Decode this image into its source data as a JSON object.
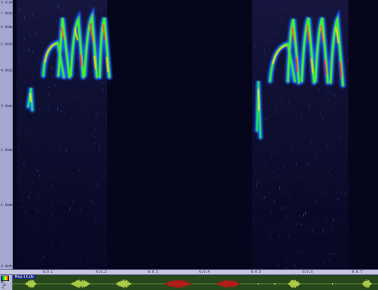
{
  "frequency_axis": {
    "labels": [
      "0.618kHz",
      "7.8kHz",
      "6.8kHz",
      "5.8kHz",
      "4.8kHz",
      "3.8kHz",
      "2.8kHz",
      "1.8kHz",
      "0.8kHz"
    ]
  },
  "time_axis": {
    "labels": [
      "0:0.1",
      "0:0.2",
      "0:0.3",
      "0:0.4",
      "0:0.5",
      "0:0.6",
      "0:0.7"
    ]
  },
  "waveform": {
    "panel_label": "Magnitude",
    "side_labels": [
      "dB",
      "-18",
      "-6"
    ]
  },
  "colors": {
    "background": "#05051c",
    "wave_panel": "#26481c",
    "wave_normal": "#b8d84a",
    "wave_selected": "#c01818",
    "axis_panel": "#a7a8d2"
  },
  "icons": {
    "color_scale": "spectrum-gradient-icon"
  }
}
